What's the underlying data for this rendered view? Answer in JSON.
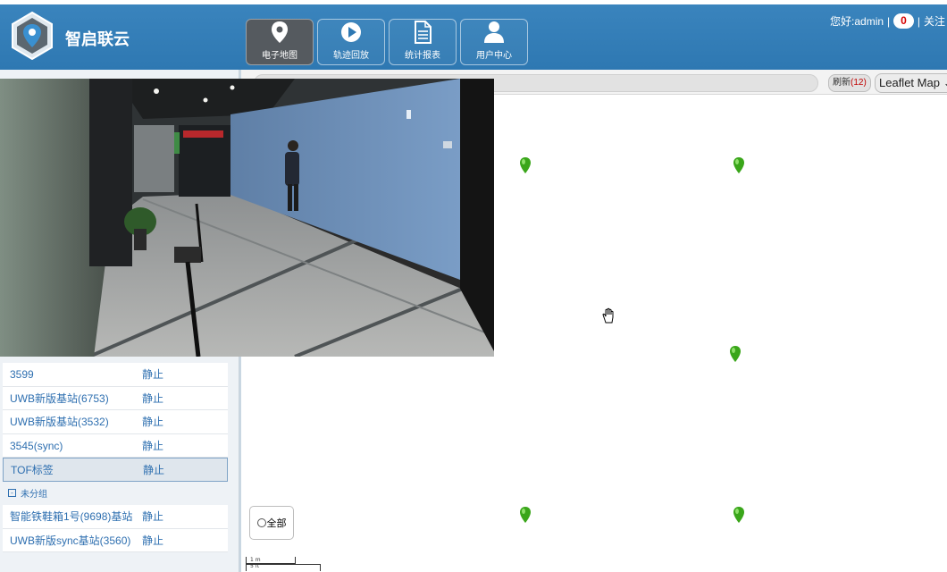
{
  "header": {
    "brand": "智启联云",
    "nav": [
      {
        "label": "电子地图",
        "icon": "map-pin-icon",
        "active": true
      },
      {
        "label": "轨迹回放",
        "icon": "play-icon",
        "active": false
      },
      {
        "label": "统计报表",
        "icon": "document-icon",
        "active": false
      },
      {
        "label": "用户中心",
        "icon": "user-icon",
        "active": false
      }
    ],
    "greeting": "您好:admin",
    "sep1": "|",
    "notification_count": "0",
    "sep2": "|",
    "follow": "关注"
  },
  "map": {
    "refresh_label": "刷新",
    "refresh_count": "(12)",
    "map_type": "Leaflet Map",
    "all_label": "全部",
    "scale_metric": "1 m",
    "scale_imperial": "5 ft"
  },
  "device_list": {
    "rows": [
      {
        "name": "3599",
        "status": "静止"
      },
      {
        "name": "UWB新版基站(6753)",
        "status": "静止"
      },
      {
        "name": "UWB新版基站(3532)",
        "status": "静止"
      },
      {
        "name": "3545(sync)",
        "status": "静止"
      },
      {
        "name": "TOF标签",
        "status": "静止",
        "selected": true
      }
    ],
    "group_label": "未分组",
    "group_rows": [
      {
        "name": "智能铁鞋箱1号(9698)基站",
        "status": "静止"
      },
      {
        "name": "UWB新版sync基站(3560)",
        "status": "静止"
      }
    ]
  },
  "colors": {
    "header_blue": "#2e78b2",
    "pin_green": "#3aa61a",
    "list_text": "#2e6fb0",
    "badge_red": "#d40000"
  }
}
